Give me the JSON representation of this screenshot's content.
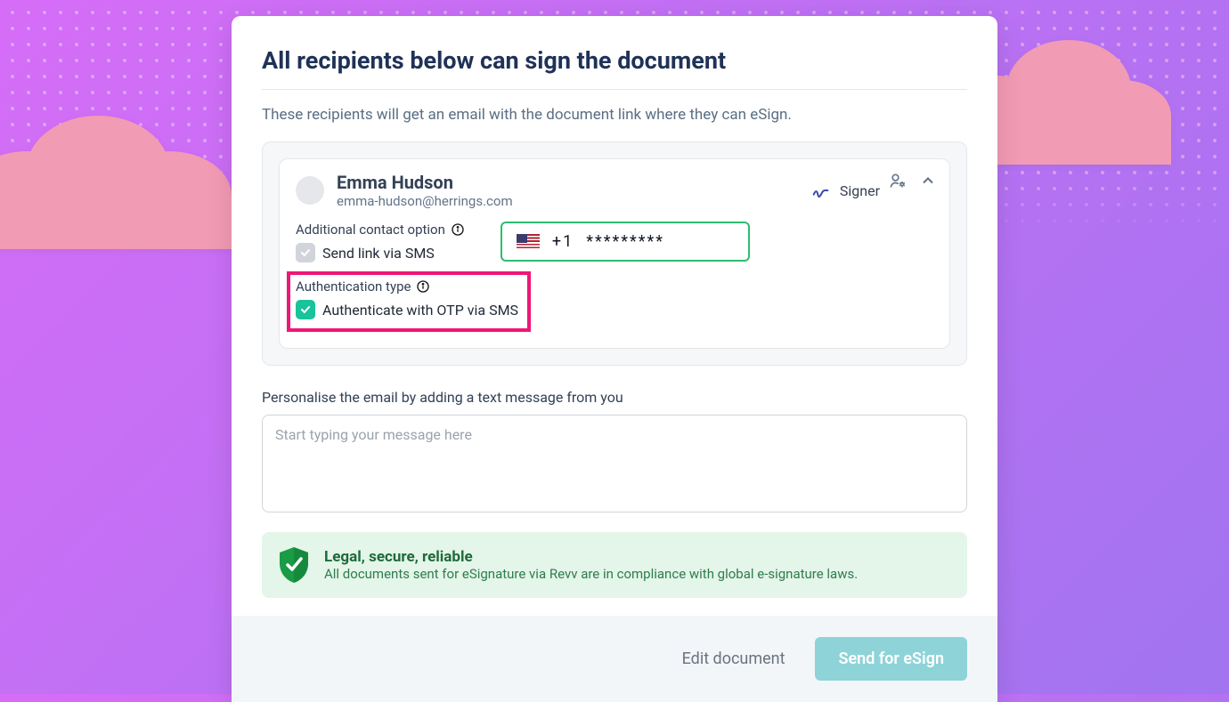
{
  "title": "All recipients below can sign the document",
  "subtitle": "These recipients will get an email with the document link where they can eSign.",
  "recipient": {
    "name": "Emma Hudson",
    "email": "emma-hudson@herrings.com",
    "role": "Signer",
    "additional_contact_label": "Additional contact option",
    "send_sms_label": "Send link via SMS",
    "send_sms_checked": false,
    "phone_country_code": "+1",
    "phone_masked": "*********",
    "auth_type_label": "Authentication type",
    "auth_otp_label": "Authenticate with OTP via SMS",
    "auth_otp_checked": true
  },
  "personalise_label": "Personalise the email by adding a text message from you",
  "message_placeholder": "Start typing your message here",
  "legal": {
    "title": "Legal, secure, reliable",
    "text": "All documents sent for eSignature via Revv are in compliance with global e-signature laws."
  },
  "footer": {
    "edit": "Edit document",
    "send": "Send for eSign"
  },
  "colors": {
    "accent_green": "#19c39c",
    "highlight_pink": "#ef1676",
    "primary_button": "#8ed3d8"
  }
}
